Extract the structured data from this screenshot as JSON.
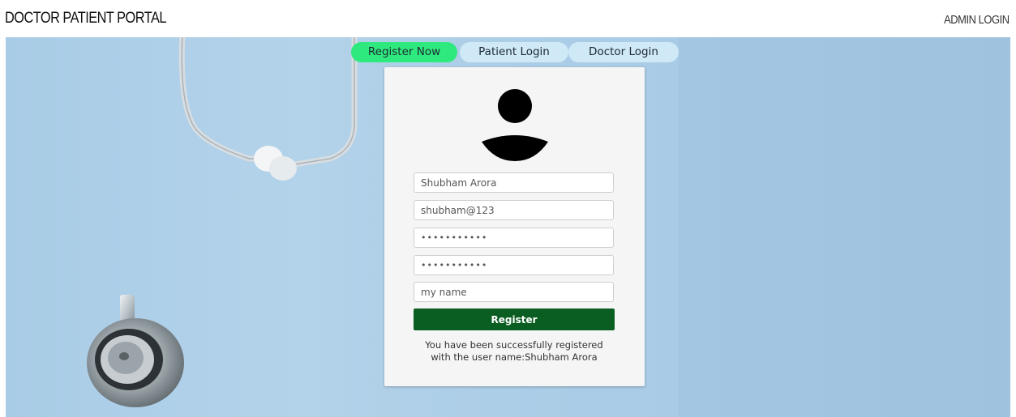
{
  "header": {
    "brand": "DOCTOR PATIENT PORTAL",
    "admin_link": "ADMIN LOGIN"
  },
  "tabs": [
    {
      "label": "Register Now",
      "active": true
    },
    {
      "label": "Patient Login",
      "active": false
    },
    {
      "label": "Doctor Login",
      "active": false
    }
  ],
  "form": {
    "name_value": "Shubham Arora",
    "username_value": "shubham@123",
    "password_value": "•••••••••••",
    "confirm_password_value": "•••••••••••",
    "extra_value": "my name",
    "register_label": "Register",
    "message_line1": "You have been successfully registered",
    "message_line2": "with the user name:Shubham Arora"
  },
  "icons": {
    "avatar": "user-avatar-icon",
    "background": "stethoscope-image"
  },
  "colors": {
    "tab_active": "#2ee97e",
    "tab_inactive": "#cfe9f7",
    "register_button": "#0b5e21",
    "hero_background": "#a9cce6"
  }
}
